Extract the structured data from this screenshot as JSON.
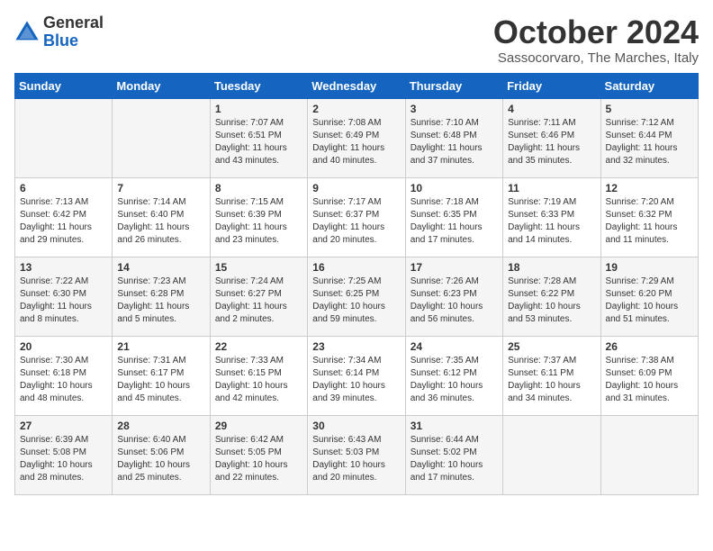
{
  "header": {
    "logo_general": "General",
    "logo_blue": "Blue",
    "month": "October 2024",
    "location": "Sassocorvaro, The Marches, Italy"
  },
  "weekdays": [
    "Sunday",
    "Monday",
    "Tuesday",
    "Wednesday",
    "Thursday",
    "Friday",
    "Saturday"
  ],
  "weeks": [
    [
      {
        "day": "",
        "sunrise": "",
        "sunset": "",
        "daylight": ""
      },
      {
        "day": "",
        "sunrise": "",
        "sunset": "",
        "daylight": ""
      },
      {
        "day": "1",
        "sunrise": "Sunrise: 7:07 AM",
        "sunset": "Sunset: 6:51 PM",
        "daylight": "Daylight: 11 hours and 43 minutes."
      },
      {
        "day": "2",
        "sunrise": "Sunrise: 7:08 AM",
        "sunset": "Sunset: 6:49 PM",
        "daylight": "Daylight: 11 hours and 40 minutes."
      },
      {
        "day": "3",
        "sunrise": "Sunrise: 7:10 AM",
        "sunset": "Sunset: 6:48 PM",
        "daylight": "Daylight: 11 hours and 37 minutes."
      },
      {
        "day": "4",
        "sunrise": "Sunrise: 7:11 AM",
        "sunset": "Sunset: 6:46 PM",
        "daylight": "Daylight: 11 hours and 35 minutes."
      },
      {
        "day": "5",
        "sunrise": "Sunrise: 7:12 AM",
        "sunset": "Sunset: 6:44 PM",
        "daylight": "Daylight: 11 hours and 32 minutes."
      }
    ],
    [
      {
        "day": "6",
        "sunrise": "Sunrise: 7:13 AM",
        "sunset": "Sunset: 6:42 PM",
        "daylight": "Daylight: 11 hours and 29 minutes."
      },
      {
        "day": "7",
        "sunrise": "Sunrise: 7:14 AM",
        "sunset": "Sunset: 6:40 PM",
        "daylight": "Daylight: 11 hours and 26 minutes."
      },
      {
        "day": "8",
        "sunrise": "Sunrise: 7:15 AM",
        "sunset": "Sunset: 6:39 PM",
        "daylight": "Daylight: 11 hours and 23 minutes."
      },
      {
        "day": "9",
        "sunrise": "Sunrise: 7:17 AM",
        "sunset": "Sunset: 6:37 PM",
        "daylight": "Daylight: 11 hours and 20 minutes."
      },
      {
        "day": "10",
        "sunrise": "Sunrise: 7:18 AM",
        "sunset": "Sunset: 6:35 PM",
        "daylight": "Daylight: 11 hours and 17 minutes."
      },
      {
        "day": "11",
        "sunrise": "Sunrise: 7:19 AM",
        "sunset": "Sunset: 6:33 PM",
        "daylight": "Daylight: 11 hours and 14 minutes."
      },
      {
        "day": "12",
        "sunrise": "Sunrise: 7:20 AM",
        "sunset": "Sunset: 6:32 PM",
        "daylight": "Daylight: 11 hours and 11 minutes."
      }
    ],
    [
      {
        "day": "13",
        "sunrise": "Sunrise: 7:22 AM",
        "sunset": "Sunset: 6:30 PM",
        "daylight": "Daylight: 11 hours and 8 minutes."
      },
      {
        "day": "14",
        "sunrise": "Sunrise: 7:23 AM",
        "sunset": "Sunset: 6:28 PM",
        "daylight": "Daylight: 11 hours and 5 minutes."
      },
      {
        "day": "15",
        "sunrise": "Sunrise: 7:24 AM",
        "sunset": "Sunset: 6:27 PM",
        "daylight": "Daylight: 11 hours and 2 minutes."
      },
      {
        "day": "16",
        "sunrise": "Sunrise: 7:25 AM",
        "sunset": "Sunset: 6:25 PM",
        "daylight": "Daylight: 10 hours and 59 minutes."
      },
      {
        "day": "17",
        "sunrise": "Sunrise: 7:26 AM",
        "sunset": "Sunset: 6:23 PM",
        "daylight": "Daylight: 10 hours and 56 minutes."
      },
      {
        "day": "18",
        "sunrise": "Sunrise: 7:28 AM",
        "sunset": "Sunset: 6:22 PM",
        "daylight": "Daylight: 10 hours and 53 minutes."
      },
      {
        "day": "19",
        "sunrise": "Sunrise: 7:29 AM",
        "sunset": "Sunset: 6:20 PM",
        "daylight": "Daylight: 10 hours and 51 minutes."
      }
    ],
    [
      {
        "day": "20",
        "sunrise": "Sunrise: 7:30 AM",
        "sunset": "Sunset: 6:18 PM",
        "daylight": "Daylight: 10 hours and 48 minutes."
      },
      {
        "day": "21",
        "sunrise": "Sunrise: 7:31 AM",
        "sunset": "Sunset: 6:17 PM",
        "daylight": "Daylight: 10 hours and 45 minutes."
      },
      {
        "day": "22",
        "sunrise": "Sunrise: 7:33 AM",
        "sunset": "Sunset: 6:15 PM",
        "daylight": "Daylight: 10 hours and 42 minutes."
      },
      {
        "day": "23",
        "sunrise": "Sunrise: 7:34 AM",
        "sunset": "Sunset: 6:14 PM",
        "daylight": "Daylight: 10 hours and 39 minutes."
      },
      {
        "day": "24",
        "sunrise": "Sunrise: 7:35 AM",
        "sunset": "Sunset: 6:12 PM",
        "daylight": "Daylight: 10 hours and 36 minutes."
      },
      {
        "day": "25",
        "sunrise": "Sunrise: 7:37 AM",
        "sunset": "Sunset: 6:11 PM",
        "daylight": "Daylight: 10 hours and 34 minutes."
      },
      {
        "day": "26",
        "sunrise": "Sunrise: 7:38 AM",
        "sunset": "Sunset: 6:09 PM",
        "daylight": "Daylight: 10 hours and 31 minutes."
      }
    ],
    [
      {
        "day": "27",
        "sunrise": "Sunrise: 6:39 AM",
        "sunset": "Sunset: 5:08 PM",
        "daylight": "Daylight: 10 hours and 28 minutes."
      },
      {
        "day": "28",
        "sunrise": "Sunrise: 6:40 AM",
        "sunset": "Sunset: 5:06 PM",
        "daylight": "Daylight: 10 hours and 25 minutes."
      },
      {
        "day": "29",
        "sunrise": "Sunrise: 6:42 AM",
        "sunset": "Sunset: 5:05 PM",
        "daylight": "Daylight: 10 hours and 22 minutes."
      },
      {
        "day": "30",
        "sunrise": "Sunrise: 6:43 AM",
        "sunset": "Sunset: 5:03 PM",
        "daylight": "Daylight: 10 hours and 20 minutes."
      },
      {
        "day": "31",
        "sunrise": "Sunrise: 6:44 AM",
        "sunset": "Sunset: 5:02 PM",
        "daylight": "Daylight: 10 hours and 17 minutes."
      },
      {
        "day": "",
        "sunrise": "",
        "sunset": "",
        "daylight": ""
      },
      {
        "day": "",
        "sunrise": "",
        "sunset": "",
        "daylight": ""
      }
    ]
  ]
}
